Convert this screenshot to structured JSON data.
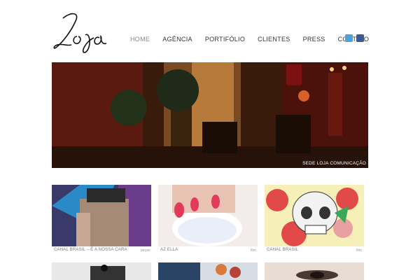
{
  "brand": {
    "logo_text": "Loja"
  },
  "nav": {
    "items": [
      {
        "label": "HOME",
        "active": true
      },
      {
        "label": "AGÊNCIA"
      },
      {
        "label": "PORTIFÓLIO"
      },
      {
        "label": "CLIENTES"
      },
      {
        "label": "PRESS"
      },
      {
        "label": "CONTATO"
      }
    ]
  },
  "social": [
    "twitter-icon",
    "facebook-icon"
  ],
  "hero": {
    "caption": "SEDE LOJA COMUNICAÇÃO"
  },
  "portfolio": [
    {
      "title": "CANAL BRASIL – É A NOSSA CARA",
      "tag": "peças"
    },
    {
      "title": "AZ ELLA",
      "tag": "film"
    },
    {
      "title": "CANAL BRASIL",
      "tag": "film"
    }
  ],
  "colors": {
    "twitter": "#4aa3df",
    "facebook": "#3b5998",
    "nav_active": "#888888"
  }
}
